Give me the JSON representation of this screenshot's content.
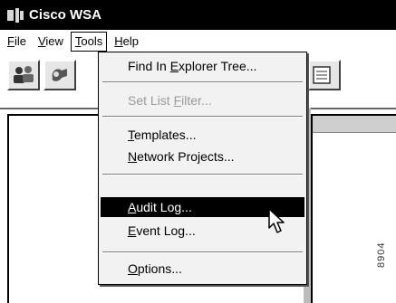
{
  "window": {
    "title": "Cisco WSA"
  },
  "menubar": {
    "items": [
      {
        "label": "File",
        "key": "F",
        "rest": "ile"
      },
      {
        "label": "View",
        "key": "V",
        "rest": "iew"
      },
      {
        "label": "Tools",
        "key": "T",
        "rest": "ools"
      },
      {
        "label": "Help",
        "key": "H",
        "rest": "elp"
      }
    ]
  },
  "tools_menu": {
    "items": [
      {
        "pre": "Find In ",
        "key": "E",
        "rest": "xplorer Tree...",
        "enabled": true
      },
      {
        "pre": "Set List ",
        "key": "F",
        "rest": "ilter...",
        "enabled": false
      },
      {
        "pre": "",
        "key": "T",
        "rest": "emplates...",
        "enabled": true
      },
      {
        "pre": "",
        "key": "N",
        "rest": "etwork Projects...",
        "enabled": true
      },
      {
        "pre": "",
        "key": "A",
        "rest": "udit Log...",
        "enabled": true,
        "highlighted": true
      },
      {
        "pre": "",
        "key": "E",
        "rest": "vent Log...",
        "enabled": true
      },
      {
        "pre": "",
        "key": "O",
        "rest": "ptions...",
        "enabled": true
      }
    ]
  },
  "figure_number": "8904",
  "toolbar": {
    "icons": [
      "users-icon",
      "network-icon",
      "document-icon"
    ]
  }
}
